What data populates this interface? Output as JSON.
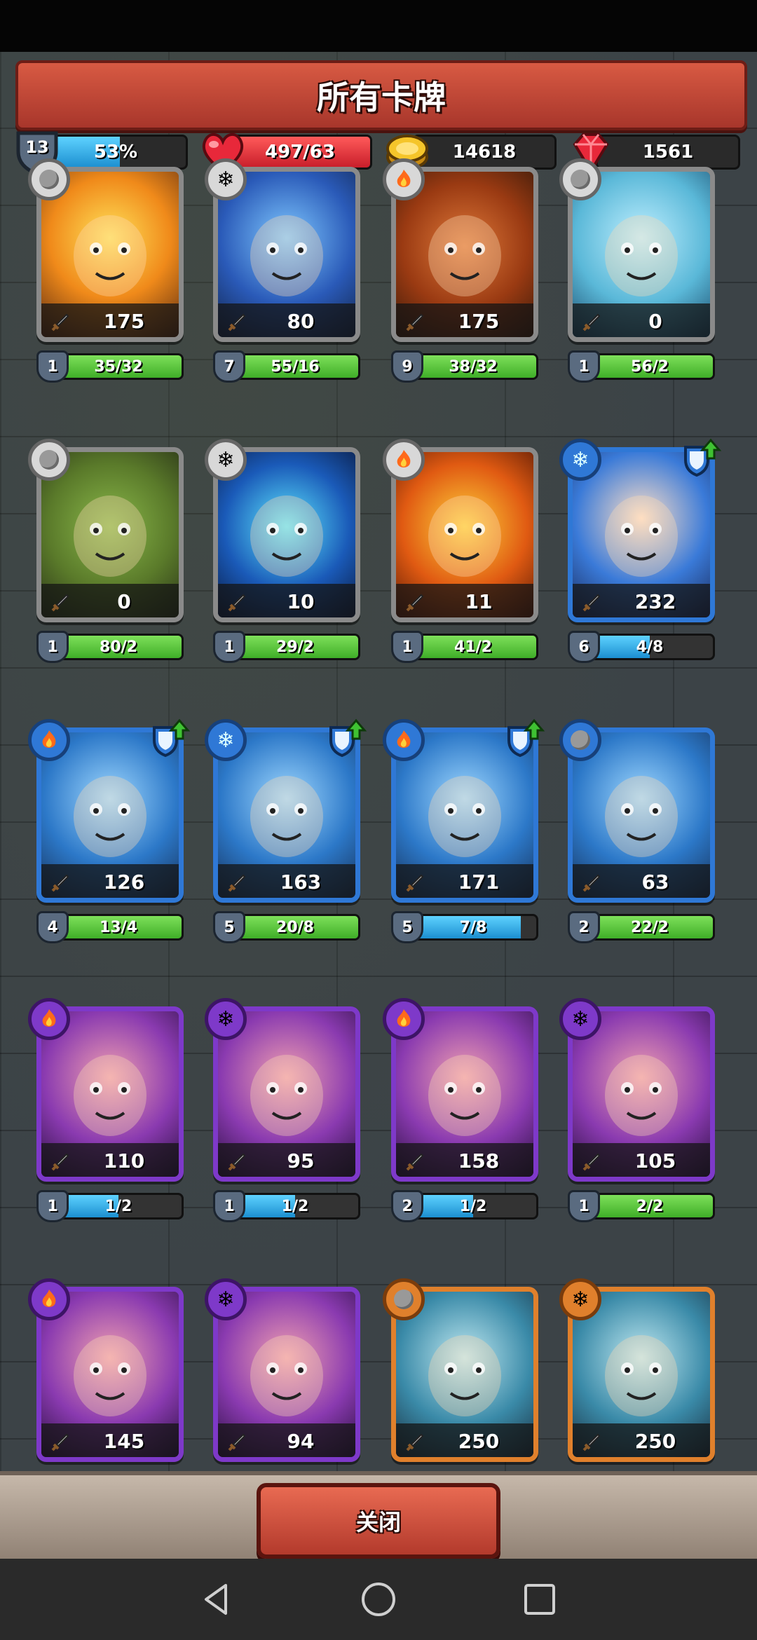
{
  "header": {
    "title": "所有卡牌"
  },
  "resources": {
    "level": "13",
    "xp_text": "53%",
    "xp_fraction": 0.53,
    "hearts_text": "497/63",
    "gold_text": "14618",
    "gems_text": "1561"
  },
  "cards": [
    {
      "power": "175",
      "level": "1",
      "progress": "35/32",
      "fill": 1.0,
      "bar": "green",
      "frame": "gray",
      "element": "stone"
    },
    {
      "power": "80",
      "level": "7",
      "progress": "55/16",
      "fill": 1.0,
      "bar": "green",
      "frame": "gray",
      "element": "ice"
    },
    {
      "power": "175",
      "level": "9",
      "progress": "38/32",
      "fill": 1.0,
      "bar": "green",
      "frame": "gray",
      "element": "fire"
    },
    {
      "power": "0",
      "level": "1",
      "progress": "56/2",
      "fill": 1.0,
      "bar": "green",
      "frame": "gray",
      "element": "stone"
    },
    {
      "power": "0",
      "level": "1",
      "progress": "80/2",
      "fill": 1.0,
      "bar": "green",
      "frame": "gray",
      "element": "stone"
    },
    {
      "power": "10",
      "level": "1",
      "progress": "29/2",
      "fill": 1.0,
      "bar": "green",
      "frame": "gray",
      "element": "ice"
    },
    {
      "power": "11",
      "level": "1",
      "progress": "41/2",
      "fill": 1.0,
      "bar": "green",
      "frame": "gray",
      "element": "fire"
    },
    {
      "power": "232",
      "level": "6",
      "progress": "4/8",
      "fill": 0.5,
      "bar": "blue",
      "frame": "blue",
      "element": "ice",
      "upgrade": true
    },
    {
      "power": "126",
      "level": "4",
      "progress": "13/4",
      "fill": 1.0,
      "bar": "green",
      "frame": "blue",
      "element": "fire",
      "upgrade": true
    },
    {
      "power": "163",
      "level": "5",
      "progress": "20/8",
      "fill": 1.0,
      "bar": "green",
      "frame": "blue",
      "element": "ice",
      "upgrade": true
    },
    {
      "power": "171",
      "level": "5",
      "progress": "7/8",
      "fill": 0.875,
      "bar": "blue",
      "frame": "blue",
      "element": "fire",
      "upgrade": true
    },
    {
      "power": "63",
      "level": "2",
      "progress": "22/2",
      "fill": 1.0,
      "bar": "green",
      "frame": "blue",
      "element": "stone"
    },
    {
      "power": "110",
      "level": "1",
      "progress": "1/2",
      "fill": 0.5,
      "bar": "blue",
      "frame": "purple",
      "element": "fire"
    },
    {
      "power": "95",
      "level": "1",
      "progress": "1/2",
      "fill": 0.5,
      "bar": "blue",
      "frame": "purple",
      "element": "ice"
    },
    {
      "power": "158",
      "level": "2",
      "progress": "1/2",
      "fill": 0.5,
      "bar": "blue",
      "frame": "purple",
      "element": "fire"
    },
    {
      "power": "105",
      "level": "1",
      "progress": "2/2",
      "fill": 1.0,
      "bar": "green",
      "frame": "purple",
      "element": "ice"
    },
    {
      "power": "145",
      "frame": "purple",
      "element": "fire"
    },
    {
      "power": "94",
      "frame": "purple",
      "element": "ice"
    },
    {
      "power": "250",
      "frame": "orange",
      "element": "stone"
    },
    {
      "power": "250",
      "frame": "orange",
      "element": "ice"
    }
  ],
  "footer": {
    "close_label": "关闭"
  },
  "colors": {
    "banner": "#c94a37",
    "green": "#4fc232",
    "blue": "#2aa6e6"
  }
}
